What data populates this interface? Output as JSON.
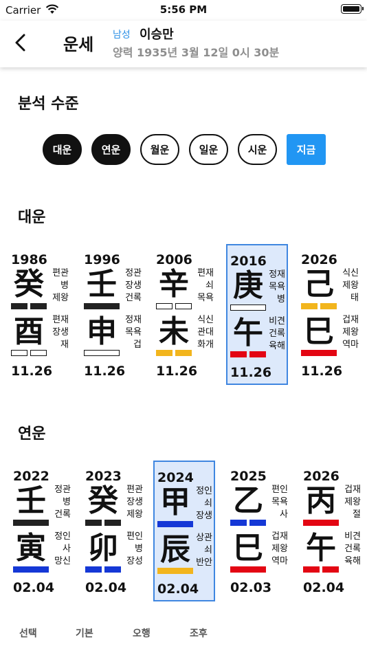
{
  "status": {
    "carrier": "Carrier",
    "time": "5:56 PM"
  },
  "nav": {
    "title": "운세",
    "gender": "남성",
    "name": "이승만",
    "birth": "양력 1935년 3월 12일 0시 30분"
  },
  "analysis": {
    "title": "분석 수준",
    "levels": [
      {
        "label": "대운",
        "state": "on"
      },
      {
        "label": "연운",
        "state": "on"
      },
      {
        "label": "월운",
        "state": "off"
      },
      {
        "label": "일운",
        "state": "off"
      },
      {
        "label": "시운",
        "state": "off"
      },
      {
        "label": "지금",
        "state": "now"
      }
    ]
  },
  "colors": {
    "black": "#222222",
    "yellow": "#f2b51d",
    "red": "#e30613",
    "blue": "#1538d6",
    "white": "#ffffff",
    "highlight_bg": "#dde9fb",
    "highlight_border": "#3f86e0",
    "accent": "#2196f3"
  },
  "daeun": {
    "title": "대운",
    "cards": [
      {
        "year": "1986",
        "stem": "癸",
        "stem_info": [
          "편관",
          "병",
          "제왕"
        ],
        "stem_colors": [
          "black",
          "black"
        ],
        "branch": "酉",
        "branch_info": [
          "편재",
          "장생",
          "재"
        ],
        "branch_colors": [
          "white",
          "white"
        ],
        "date": "11.26",
        "highlight": false
      },
      {
        "year": "1996",
        "stem": "壬",
        "stem_info": [
          "정관",
          "장생",
          "건록"
        ],
        "stem_colors": [
          "black"
        ],
        "branch": "申",
        "branch_info": [
          "정재",
          "목욕",
          "겁"
        ],
        "branch_colors": [
          "white"
        ],
        "date": "11.26",
        "highlight": false
      },
      {
        "year": "2006",
        "stem": "辛",
        "stem_info": [
          "편재",
          "쇠",
          "목욕"
        ],
        "stem_colors": [
          "white",
          "white"
        ],
        "branch": "未",
        "branch_info": [
          "식신",
          "관대",
          "화개"
        ],
        "branch_colors": [
          "yellow",
          "yellow"
        ],
        "date": "11.26",
        "highlight": false
      },
      {
        "year": "2016",
        "stem": "庚",
        "stem_info": [
          "정재",
          "목욕",
          "병"
        ],
        "stem_colors": [
          "white"
        ],
        "branch": "午",
        "branch_info": [
          "비견",
          "건록",
          "육해"
        ],
        "branch_colors": [
          "red",
          "red"
        ],
        "date": "11.26",
        "highlight": true
      },
      {
        "year": "2026",
        "stem": "己",
        "stem_info": [
          "식신",
          "제왕",
          "태"
        ],
        "stem_colors": [
          "yellow",
          "yellow"
        ],
        "branch": "巳",
        "branch_info": [
          "겁재",
          "제왕",
          "역마"
        ],
        "branch_colors": [
          "red"
        ],
        "date": "11.26",
        "highlight": false
      }
    ]
  },
  "yeonun": {
    "title": "연운",
    "cards": [
      {
        "year": "2022",
        "stem": "壬",
        "stem_info": [
          "정관",
          "병",
          "건록"
        ],
        "stem_colors": [
          "black"
        ],
        "branch": "寅",
        "branch_info": [
          "정인",
          "사",
          "망신"
        ],
        "branch_colors": [
          "blue"
        ],
        "date": "02.04",
        "highlight": false
      },
      {
        "year": "2023",
        "stem": "癸",
        "stem_info": [
          "편관",
          "장생",
          "제왕"
        ],
        "stem_colors": [
          "black",
          "black"
        ],
        "branch": "卯",
        "branch_info": [
          "편인",
          "병",
          "장성"
        ],
        "branch_colors": [
          "blue",
          "blue"
        ],
        "date": "02.04",
        "highlight": false
      },
      {
        "year": "2024",
        "stem": "甲",
        "stem_info": [
          "정인",
          "쇠",
          "장생"
        ],
        "stem_colors": [
          "blue"
        ],
        "branch": "辰",
        "branch_info": [
          "상관",
          "쇠",
          "반안"
        ],
        "branch_colors": [
          "yellow"
        ],
        "date": "02.04",
        "highlight": true
      },
      {
        "year": "2025",
        "stem": "乙",
        "stem_info": [
          "편인",
          "목욕",
          "사"
        ],
        "stem_colors": [
          "blue",
          "blue"
        ],
        "branch": "巳",
        "branch_info": [
          "겁재",
          "제왕",
          "역마"
        ],
        "branch_colors": [
          "red"
        ],
        "date": "02.03",
        "highlight": false
      },
      {
        "year": "2026",
        "stem": "丙",
        "stem_info": [
          "겁재",
          "제왕",
          "절"
        ],
        "stem_colors": [
          "red"
        ],
        "branch": "午",
        "branch_info": [
          "비견",
          "건록",
          "육해"
        ],
        "branch_colors": [
          "red",
          "red"
        ],
        "date": "02.04",
        "highlight": false
      }
    ]
  },
  "tabs": [
    "선택",
    "기본",
    "오행",
    "조후"
  ]
}
